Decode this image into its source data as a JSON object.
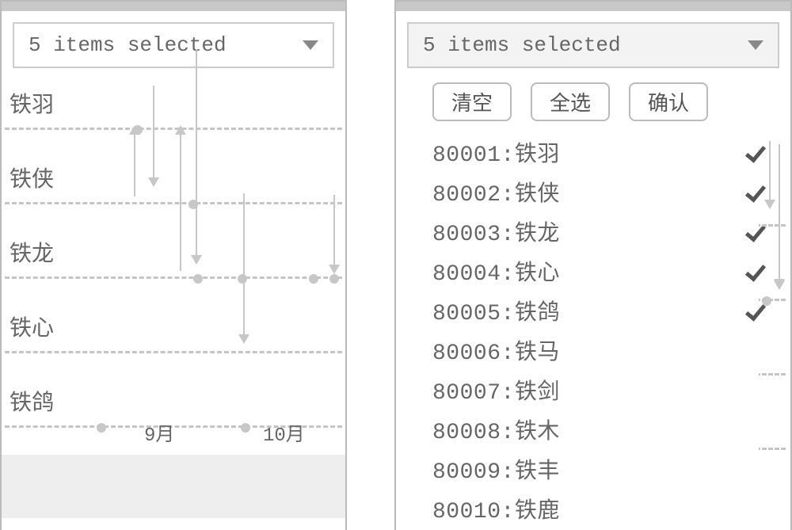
{
  "left": {
    "dropdown_label": "5 items selected",
    "series": [
      "铁羽",
      "铁侠",
      "铁龙",
      "铁心",
      "铁鸽"
    ],
    "x_ticks": [
      "9月",
      "10月"
    ]
  },
  "right": {
    "dropdown_label": "5 items selected",
    "buttons": {
      "clear": "清空",
      "select_all": "全选",
      "confirm": "确认"
    },
    "items": [
      {
        "code": "80001",
        "name": "铁羽",
        "checked": true
      },
      {
        "code": "80002",
        "name": "铁侠",
        "checked": true
      },
      {
        "code": "80003",
        "name": "铁龙",
        "checked": true
      },
      {
        "code": "80004",
        "name": "铁心",
        "checked": true
      },
      {
        "code": "80005",
        "name": "铁鸽",
        "checked": true
      },
      {
        "code": "80006",
        "name": "铁马",
        "checked": false
      },
      {
        "code": "80007",
        "name": "铁剑",
        "checked": false
      },
      {
        "code": "80008",
        "name": "铁木",
        "checked": false
      },
      {
        "code": "80009",
        "name": "铁丰",
        "checked": false
      },
      {
        "code": "80010",
        "name": "铁鹿",
        "checked": false
      }
    ]
  },
  "chart_data": {
    "type": "scatter",
    "title": "",
    "xlabel": "",
    "ylabel": "",
    "categories": [
      "铁羽",
      "铁侠",
      "铁龙",
      "铁心",
      "铁鸽"
    ],
    "x_ticks": [
      "9月",
      "10月"
    ],
    "points": [
      {
        "series": "铁羽",
        "x": "8月末",
        "note": "start-marker"
      },
      {
        "series": "铁侠",
        "x": "9月中",
        "note": "marker"
      },
      {
        "series": "铁龙",
        "x": "9月中",
        "note": "marker"
      },
      {
        "series": "铁龙",
        "x": "10月",
        "note": "marker"
      },
      {
        "series": "铁龙",
        "x": "10月后",
        "note": "marker"
      },
      {
        "series": "铁鸽",
        "x": "8月末",
        "note": "marker"
      },
      {
        "series": "铁鸽",
        "x": "9月末",
        "note": "marker"
      }
    ],
    "arrows": [
      {
        "from": "铁羽",
        "to": "铁侠",
        "x": "8月末",
        "dir": "up"
      },
      {
        "from": "铁羽",
        "to": "铁侠",
        "x": "9月初",
        "dir": "down"
      },
      {
        "from": "铁羽",
        "to": "铁龙",
        "x": "9月中",
        "dir": "up"
      },
      {
        "from": "铁羽",
        "to": "铁龙",
        "x": "9月末",
        "dir": "down"
      },
      {
        "from": "铁龙",
        "to": "铁鸽",
        "x": "9月末",
        "dir": "down"
      },
      {
        "from": "铁龙",
        "to": "铁心",
        "x": "10月后",
        "dir": "down"
      }
    ]
  }
}
